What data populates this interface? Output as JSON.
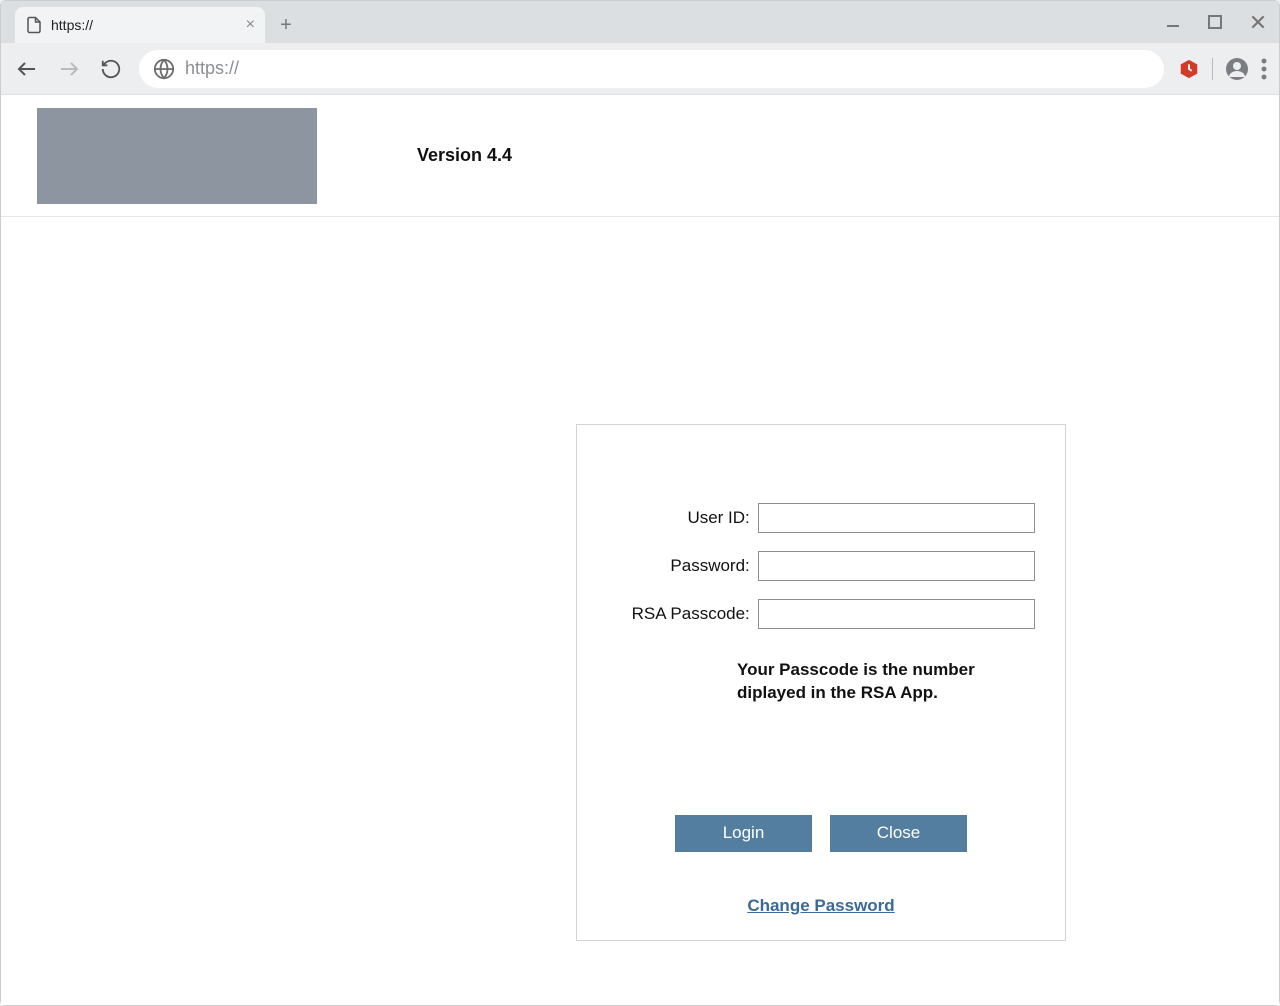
{
  "browser": {
    "tab_title": "https://",
    "url": "https://"
  },
  "header": {
    "version_label": "Version 4.4"
  },
  "login": {
    "user_id_label": "User ID:",
    "user_id_value": "",
    "password_label": "Password:",
    "password_value": "",
    "rsa_label": "RSA Passcode:",
    "rsa_value": "",
    "hint": "Your Passcode is the number diplayed in the RSA App.",
    "login_button": "Login",
    "close_button": "Close",
    "change_password": "Change Password"
  }
}
